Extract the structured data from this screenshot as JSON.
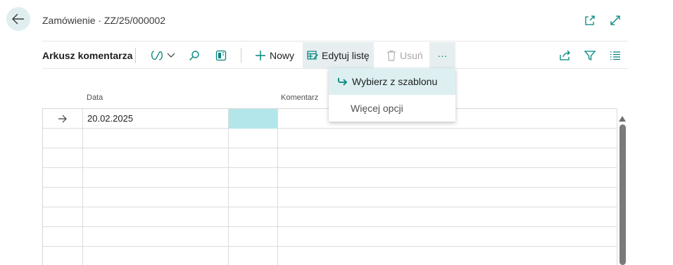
{
  "header": {
    "breadcrumb": "Zamówienie · ZZ/25/000002"
  },
  "toolbar": {
    "title": "Arkusz komentarza",
    "new_label": "Nowy",
    "edit_list_label": "Edytuj listę",
    "delete_label": "Usuń",
    "more_label": "···"
  },
  "grid": {
    "columns": [
      "Data",
      "Komentarz"
    ],
    "rows": [
      {
        "indicator": "→",
        "date": "20.02.2025",
        "comment": ""
      }
    ]
  },
  "menu": {
    "items": [
      {
        "label": "Wybierz z szablonu"
      },
      {
        "label": "Więcej opcji"
      }
    ]
  },
  "colors": {
    "accent": "#00857c",
    "selected_cell": "#b3e6ea",
    "menu_highlight": "#ddeff1"
  }
}
